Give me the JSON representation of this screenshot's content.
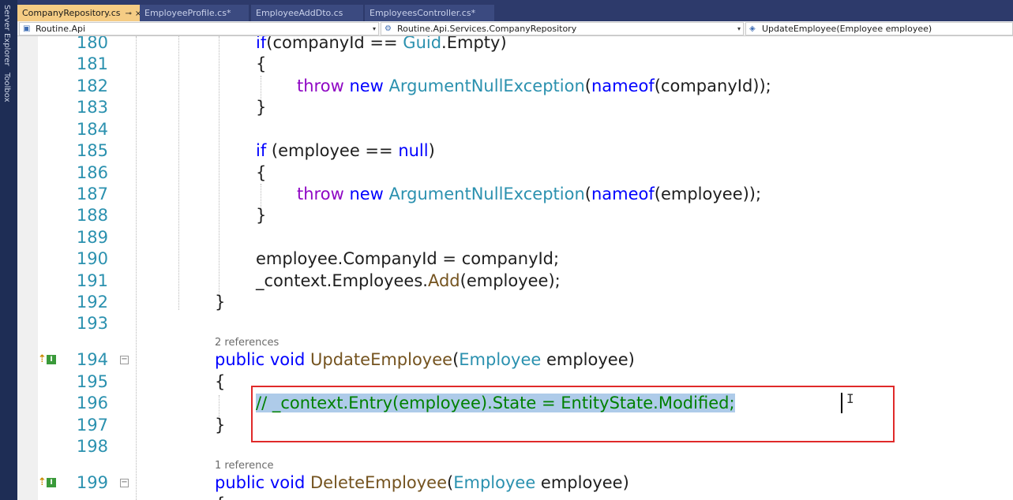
{
  "side_panels": [
    "Server Explorer",
    "Toolbox"
  ],
  "tabs": [
    {
      "label": "CompanyRepository.cs",
      "pin": "⊸",
      "close": "×",
      "active": true
    },
    {
      "label": "EmployeeProfile.cs*",
      "active": false
    },
    {
      "label": "EmployeeAddDto.cs",
      "active": false
    },
    {
      "label": "EmployeesController.cs*",
      "active": false
    }
  ],
  "nav": {
    "project": "Routine.Api",
    "class": "Routine.Api.Services.CompanyRepository",
    "member": "UpdateEmployee(Employee employee)"
  },
  "codelens": {
    "update_refs": "2 references",
    "delete_refs": "1 reference"
  },
  "line_numbers": [
    "180",
    "181",
    "182",
    "183",
    "184",
    "185",
    "186",
    "187",
    "188",
    "189",
    "190",
    "191",
    "192",
    "193",
    "194",
    "195",
    "196",
    "197",
    "198",
    "199"
  ],
  "code": {
    "l180_a": "if (",
    "l180_b": "companyId == ",
    "l180_c": "Guid",
    "l180_d": ".Empty)",
    "brace_open": "{",
    "brace_close": "}",
    "throw_kw": "throw",
    "new_kw": "new",
    "exception_type": "ArgumentNullException",
    "nameof_kw": "nameof",
    "l182_arg": "(companyId));",
    "l187_arg": "(employee));",
    "open_paren": "(",
    "if_kw": "if",
    "l185_b": " (employee == ",
    "null_kw": "null",
    "close_paren": ")",
    "l190": "employee.CompanyId = companyId;",
    "l191_a": "_context.Employees.",
    "l191_b": "Add",
    "l191_c": "(employee);",
    "public_kw": "public",
    "void_kw": "void",
    "update_method": "UpdateEmployee",
    "delete_method": "DeleteEmployee",
    "employee_type": "Employee",
    "param": " employee)",
    "l196_comment": "// _context.Entry(employee).State = EntityState.Modified;"
  },
  "icons": {
    "caret_cursor": "I",
    "collapse": "−",
    "impl_up": "⇡",
    "impl_i": "I",
    "project_icon": "▣",
    "class_icon": "⚙",
    "member_icon": "◈",
    "dropdown": "▾"
  },
  "colors": {
    "keyword": "#0000ff",
    "control_keyword": "#8f08c4",
    "type": "#2b91af",
    "method": "#74531f",
    "comment": "#008000",
    "selection": "#aecbe9",
    "highlight_border": "#e02a2a",
    "active_tab": "#f5cc84"
  }
}
